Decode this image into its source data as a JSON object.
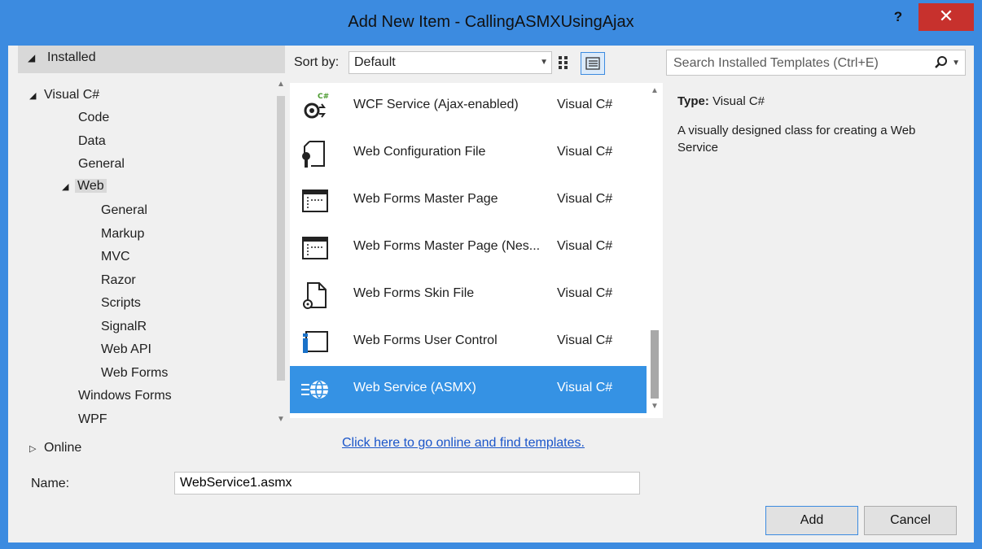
{
  "window": {
    "title": "Add New Item - CallingASMXUsingAjax",
    "help": "?",
    "close": "✕"
  },
  "tree": {
    "header": "Installed",
    "visual_csharp": "Visual C#",
    "code": "Code",
    "data": "Data",
    "general": "General",
    "web": "Web",
    "web_children": [
      "General",
      "Markup",
      "MVC",
      "Razor",
      "Scripts",
      "SignalR",
      "Web API",
      "Web Forms"
    ],
    "windows_forms": "Windows Forms",
    "wpf": "WPF",
    "online": "Online"
  },
  "toolbar": {
    "sort_label": "Sort by:",
    "sort_value": "Default",
    "search_placeholder": "Search Installed Templates (Ctrl+E)"
  },
  "templates": [
    {
      "name": "WCF Service (Ajax-enabled)",
      "lang": "Visual C#",
      "icon": "wcf-service-icon",
      "selected": false
    },
    {
      "name": "Web Configuration File",
      "lang": "Visual C#",
      "icon": "config-file-icon",
      "selected": false
    },
    {
      "name": "Web Forms Master Page",
      "lang": "Visual C#",
      "icon": "master-page-icon",
      "selected": false
    },
    {
      "name": "Web Forms Master Page (Nes... ",
      "lang": "Visual C#",
      "icon": "master-page-icon",
      "selected": false
    },
    {
      "name": "Web Forms Skin File",
      "lang": "Visual C#",
      "icon": "skin-file-icon",
      "selected": false
    },
    {
      "name": "Web Forms User Control",
      "lang": "Visual C#",
      "icon": "user-control-icon",
      "selected": false
    },
    {
      "name": "Web Service (ASMX)",
      "lang": "Visual C#",
      "icon": "web-service-icon",
      "selected": true
    }
  ],
  "online_link": "Click here to go online and find templates.",
  "details": {
    "type_label": "Type:",
    "type_value": "Visual C#",
    "description": "A visually designed class for creating a Web Service"
  },
  "name_field": {
    "label": "Name:",
    "value": "WebService1.asmx"
  },
  "buttons": {
    "add": "Add",
    "cancel": "Cancel"
  },
  "colors": {
    "titlebar": "#3c8be0",
    "selection": "#3592e4",
    "close": "#c7312d",
    "link": "#1a55c9"
  }
}
